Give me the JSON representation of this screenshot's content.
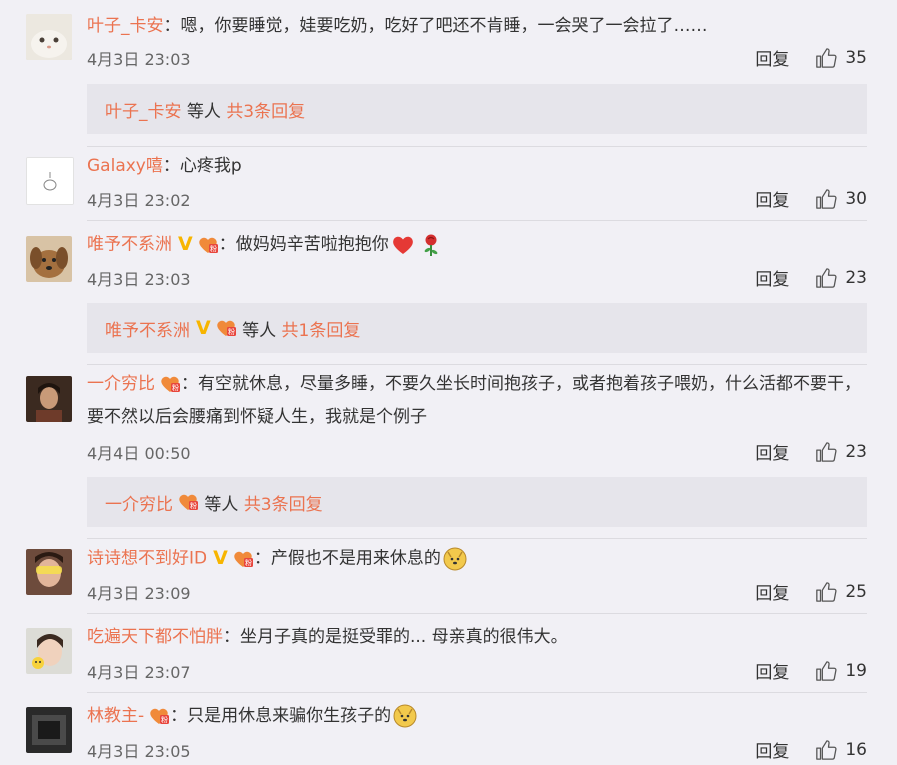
{
  "comments": [
    {
      "user": "叶子_卡安",
      "text": "：嗯，你要睡觉，娃要吃奶，吃好了吧还不肯睡，一会哭了一会拉了……",
      "time": "4月3日 23:03",
      "likes": "35",
      "sub": {
        "names": "叶子_卡安",
        "suffix": " 等人 ",
        "count": "共3条回复"
      }
    },
    {
      "user": "Galaxy嘻",
      "text": "：心疼我p",
      "time": "4月3日 23:02",
      "likes": "30"
    },
    {
      "user": "唯予不系洲",
      "text": "：做妈妈辛苦啦抱抱你",
      "time": "4月3日 23:03",
      "likes": "23",
      "sub": {
        "names": "唯予不系洲",
        "suffix": " 等人 ",
        "count": "共1条回复"
      }
    },
    {
      "user": "一介穷比",
      "text": "：有空就休息，尽量多睡，不要久坐长时间抱孩子，或者抱着孩子喂奶，什么活都不要干，要不然以后会腰痛到怀疑人生，我就是个例子",
      "time": "4月4日 00:50",
      "likes": "23",
      "sub": {
        "names": "一介穷比",
        "suffix": " 等人 ",
        "count": "共3条回复"
      }
    },
    {
      "user": "诗诗想不到好ID",
      "text": "：产假也不是用来休息的",
      "time": "4月3日 23:09",
      "likes": "25"
    },
    {
      "user": "吃遍天下都不怕胖",
      "text": "：坐月子真的是挺受罪的... 母亲真的很伟大。",
      "time": "4月3日 23:07",
      "likes": "19"
    },
    {
      "user": "林教主-",
      "text": "：只是用休息来骗你生孩子的",
      "time": "4月3日 23:05",
      "likes": "16"
    }
  ],
  "labels": {
    "reply": "回复",
    "vip_mark": "V"
  },
  "colors": {
    "username": "#eb7350",
    "background": "#f1f0f5",
    "subreply_bg": "#e6e5eb"
  },
  "icons": {
    "like": "thumbs-up-icon",
    "vip": "vip-badge-icon",
    "fan": "fan-badge-icon"
  }
}
